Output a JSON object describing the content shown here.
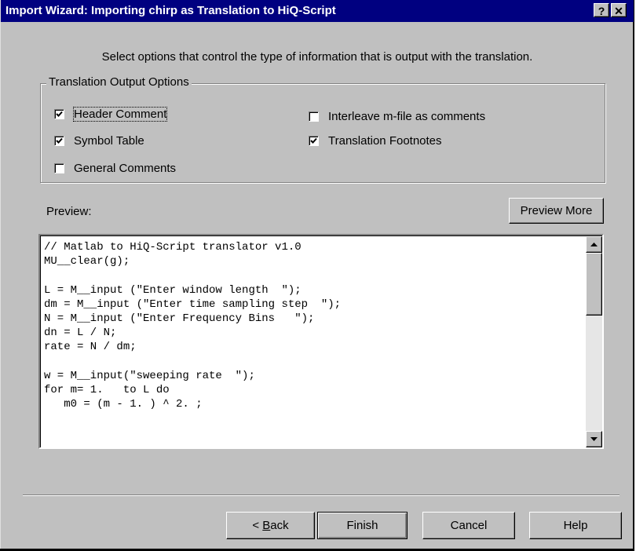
{
  "window": {
    "title": "Import Wizard: Importing chirp as Translation to HiQ-Script",
    "help_button": "?",
    "close_button": "✕"
  },
  "instructions": "Select options that control the type of information that is output with the translation.",
  "options_group": {
    "label": "Translation Output Options",
    "checkboxes": [
      {
        "label": "Header Comment",
        "checked": true
      },
      {
        "label": "Symbol Table",
        "checked": true
      },
      {
        "label": "General Comments",
        "checked": false
      },
      {
        "label": "Interleave m-file as comments",
        "checked": false
      },
      {
        "label": "Translation Footnotes",
        "checked": true
      }
    ]
  },
  "preview": {
    "label": "Preview:",
    "more_button": "Preview More",
    "code": "// Matlab to HiQ-Script translator v1.0\nMU__clear(g);\n\nL = M__input (\"Enter window length  \");\ndm = M__input (\"Enter time sampling step  \");\nN = M__input (\"Enter Frequency Bins   \");\ndn = L / N;\nrate = N / dm;\n\nw = M__input(\"sweeping rate  \");\nfor m= 1.   to L do\n   m0 = (m - 1. ) ^ 2. ;"
  },
  "buttons": {
    "back_prefix": "< ",
    "back_key": "B",
    "back_rest": "ack",
    "finish": "Finish",
    "cancel": "Cancel",
    "help": "Help"
  },
  "colors": {
    "titlebar": "#000080",
    "face": "#c0c0c0"
  }
}
